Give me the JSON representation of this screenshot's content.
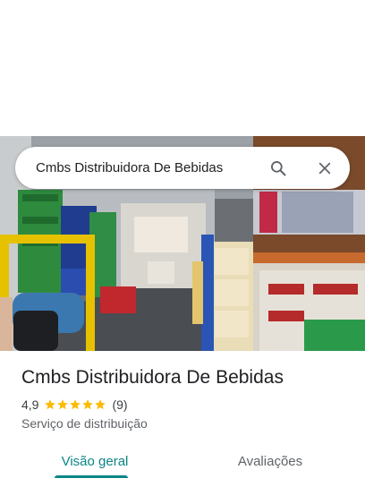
{
  "search": {
    "query": "Cmbs Distribuidora De Bebidas"
  },
  "place": {
    "name": "Cmbs Distribuidora De Bebidas",
    "rating": "4,9",
    "stars": 5,
    "review_count": "(9)",
    "category": "Serviço de distribuição"
  },
  "tabs": [
    {
      "label": "Visão geral",
      "active": true
    },
    {
      "label": "Avaliações",
      "active": false
    }
  ],
  "colors": {
    "accent": "#0b8586",
    "star": "#fbbc04",
    "text": "#202124",
    "secondary_text": "#5f6368"
  },
  "icons": {
    "search": "search-icon",
    "close": "close-icon",
    "star": "star-icon"
  }
}
